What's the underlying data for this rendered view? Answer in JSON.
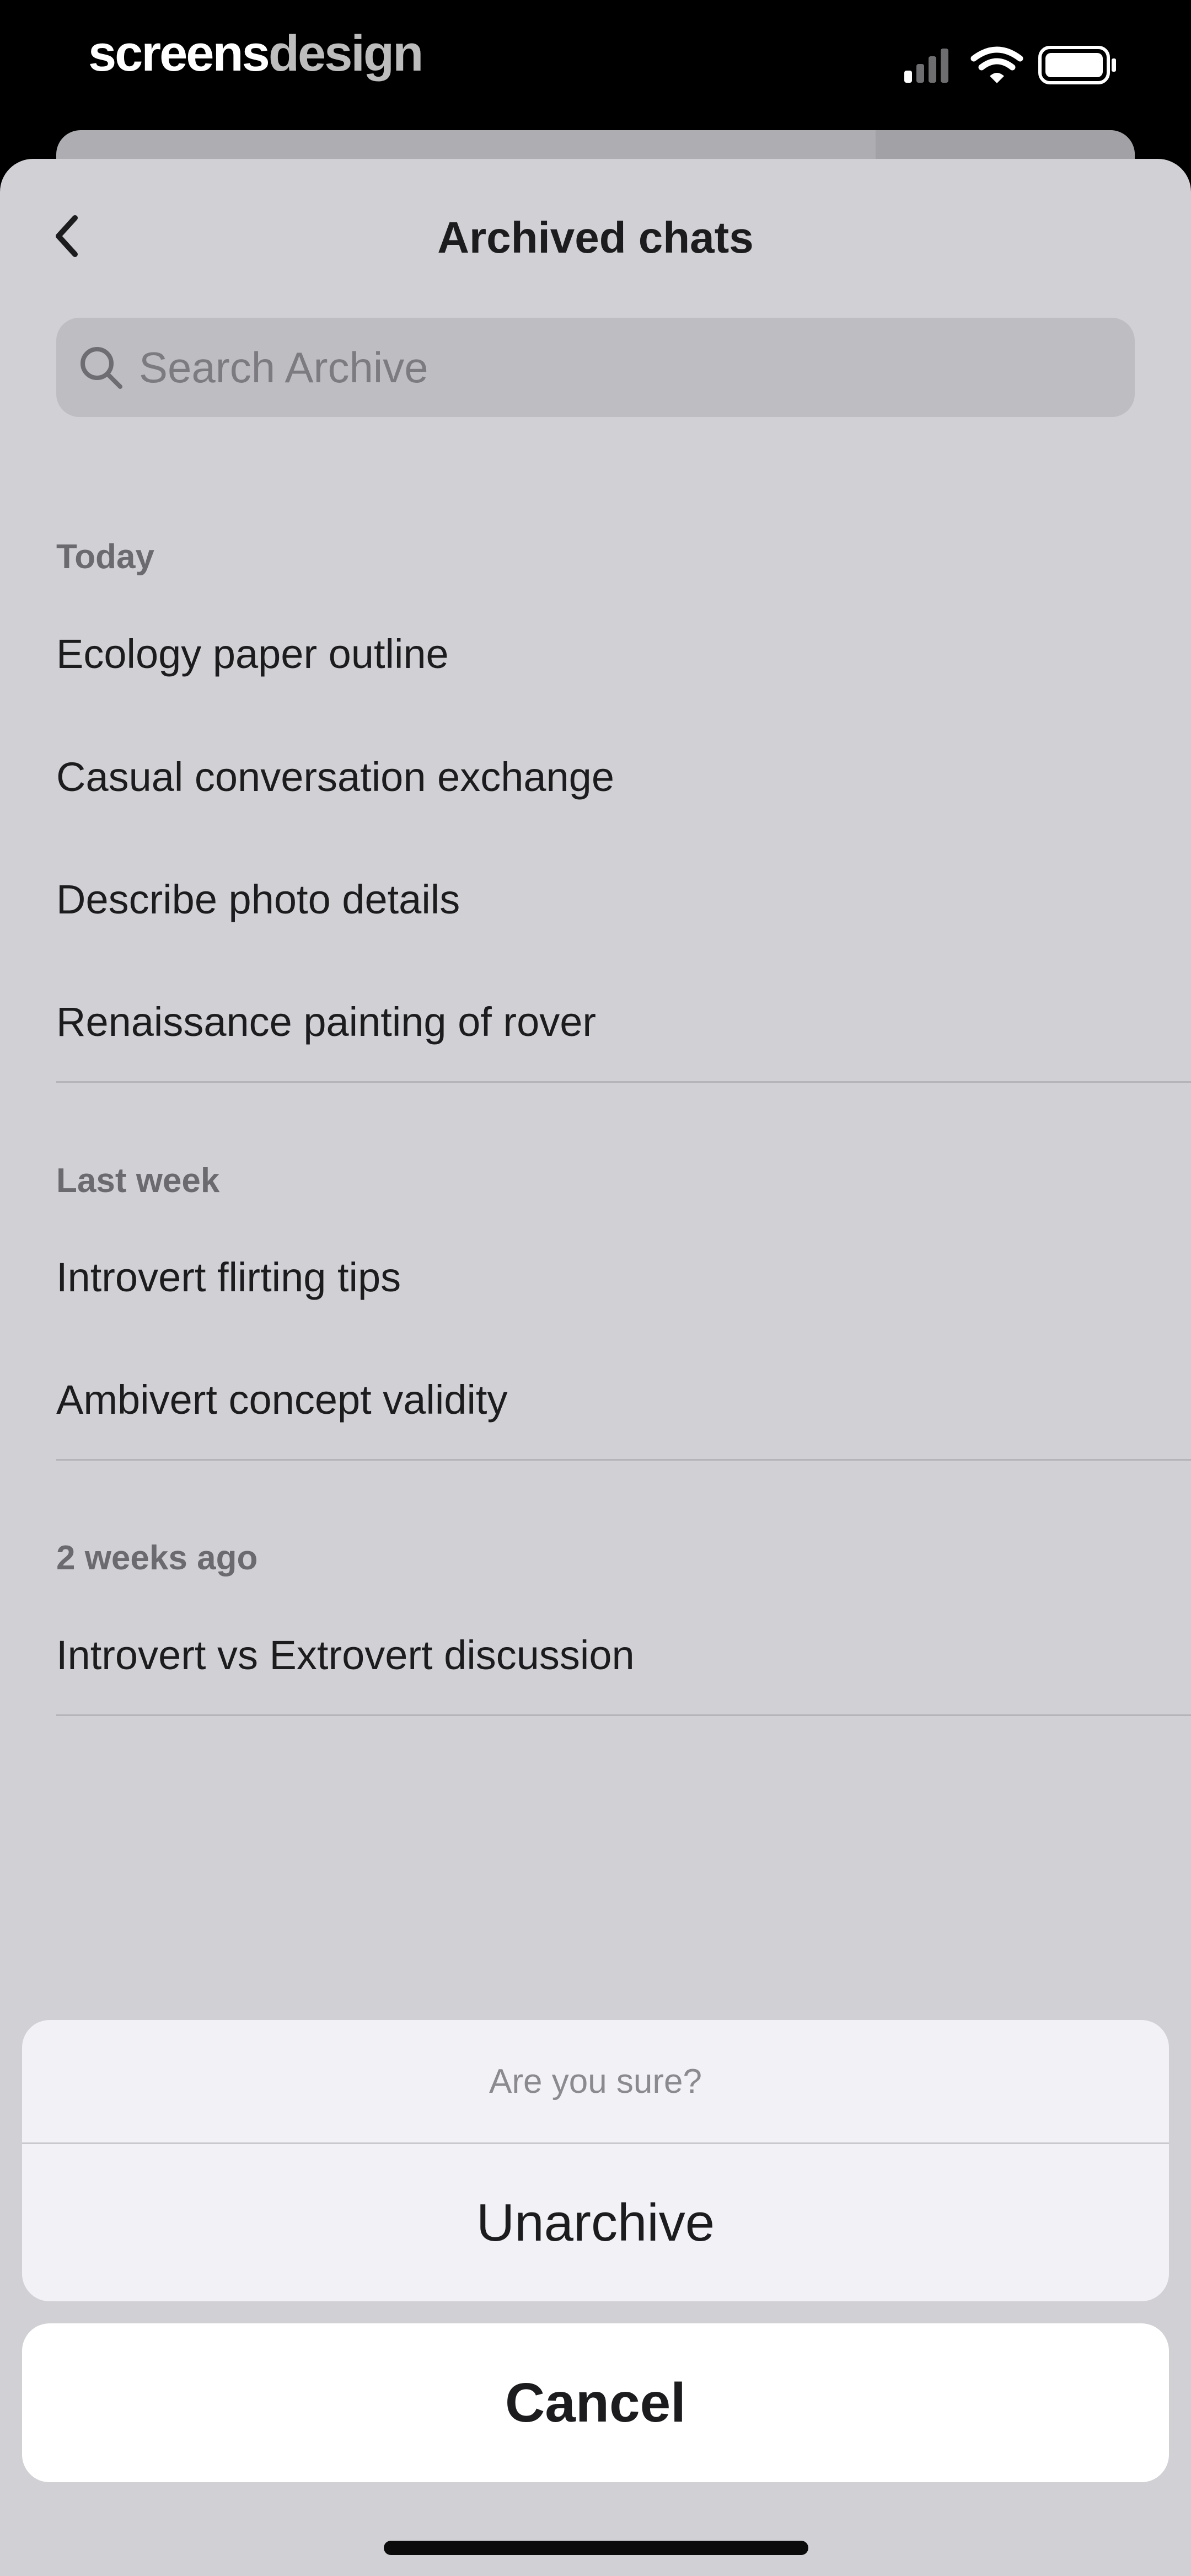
{
  "brand": {
    "part1": "screens",
    "part2": "design"
  },
  "status_bar": {
    "signal_icon": "cellular-signal-icon",
    "wifi_icon": "wifi-icon",
    "battery_icon": "battery-icon",
    "battery_level": 0.9
  },
  "nav": {
    "back_icon": "chevron-left-icon",
    "title": "Archived chats"
  },
  "search": {
    "icon": "search-icon",
    "placeholder": "Search Archive",
    "value": ""
  },
  "sections": [
    {
      "header": "Today",
      "items": [
        "Ecology paper outline",
        "Casual conversation exchange",
        "Describe photo details",
        "Renaissance painting of rover"
      ]
    },
    {
      "header": "Last week",
      "items": [
        "Introvert flirting tips",
        "Ambivert concept validity"
      ]
    },
    {
      "header": "2 weeks ago",
      "items": [
        "Introvert vs Extrovert discussion"
      ]
    }
  ],
  "action_sheet": {
    "prompt": "Are you sure?",
    "confirm_label": "Unarchive",
    "cancel_label": "Cancel"
  },
  "colors": {
    "sheet_background": "#d1d0d4",
    "text_primary": "#1c1c1e",
    "section_header": "#6b6a6f",
    "action_background": "#f2f1f5"
  }
}
